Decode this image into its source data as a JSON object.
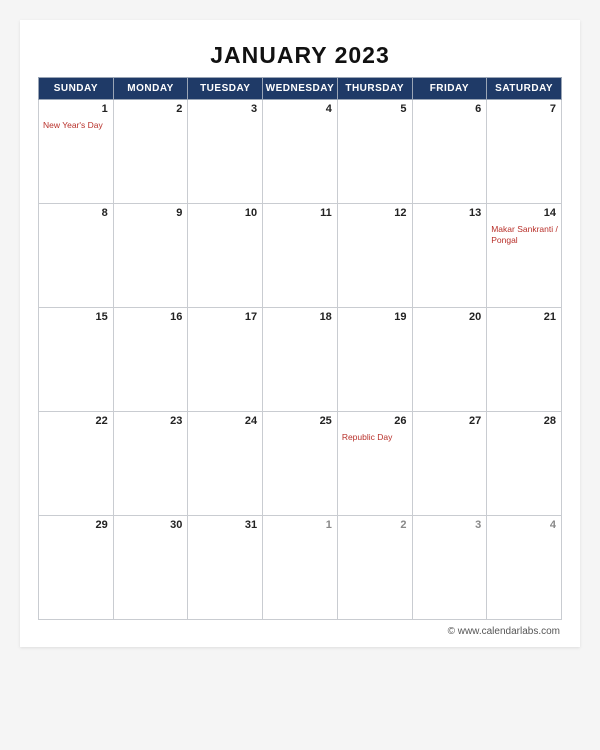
{
  "title": "JANUARY 2023",
  "dayHeaders": [
    "SUNDAY",
    "MONDAY",
    "TUESDAY",
    "WEDNESDAY",
    "THURSDAY",
    "FRIDAY",
    "SATURDAY"
  ],
  "weeks": [
    [
      {
        "num": "1",
        "note": "New Year's Day",
        "other": false
      },
      {
        "num": "2",
        "note": "",
        "other": false
      },
      {
        "num": "3",
        "note": "",
        "other": false
      },
      {
        "num": "4",
        "note": "",
        "other": false
      },
      {
        "num": "5",
        "note": "",
        "other": false
      },
      {
        "num": "6",
        "note": "",
        "other": false
      },
      {
        "num": "7",
        "note": "",
        "other": false
      }
    ],
    [
      {
        "num": "8",
        "note": "",
        "other": false
      },
      {
        "num": "9",
        "note": "",
        "other": false
      },
      {
        "num": "10",
        "note": "",
        "other": false
      },
      {
        "num": "11",
        "note": "",
        "other": false
      },
      {
        "num": "12",
        "note": "",
        "other": false
      },
      {
        "num": "13",
        "note": "",
        "other": false
      },
      {
        "num": "14",
        "note": "Makar Sankranti / Pongal",
        "other": false
      }
    ],
    [
      {
        "num": "15",
        "note": "",
        "other": false
      },
      {
        "num": "16",
        "note": "",
        "other": false
      },
      {
        "num": "17",
        "note": "",
        "other": false
      },
      {
        "num": "18",
        "note": "",
        "other": false
      },
      {
        "num": "19",
        "note": "",
        "other": false
      },
      {
        "num": "20",
        "note": "",
        "other": false
      },
      {
        "num": "21",
        "note": "",
        "other": false
      }
    ],
    [
      {
        "num": "22",
        "note": "",
        "other": false
      },
      {
        "num": "23",
        "note": "",
        "other": false
      },
      {
        "num": "24",
        "note": "",
        "other": false
      },
      {
        "num": "25",
        "note": "",
        "other": false
      },
      {
        "num": "26",
        "note": "Republic Day",
        "other": false
      },
      {
        "num": "27",
        "note": "",
        "other": false
      },
      {
        "num": "28",
        "note": "",
        "other": false
      }
    ],
    [
      {
        "num": "29",
        "note": "",
        "other": false
      },
      {
        "num": "30",
        "note": "",
        "other": false
      },
      {
        "num": "31",
        "note": "",
        "other": false
      },
      {
        "num": "1",
        "note": "",
        "other": true
      },
      {
        "num": "2",
        "note": "",
        "other": true
      },
      {
        "num": "3",
        "note": "",
        "other": true
      },
      {
        "num": "4",
        "note": "",
        "other": true
      }
    ]
  ],
  "footer": "© www.calendarlabs.com"
}
